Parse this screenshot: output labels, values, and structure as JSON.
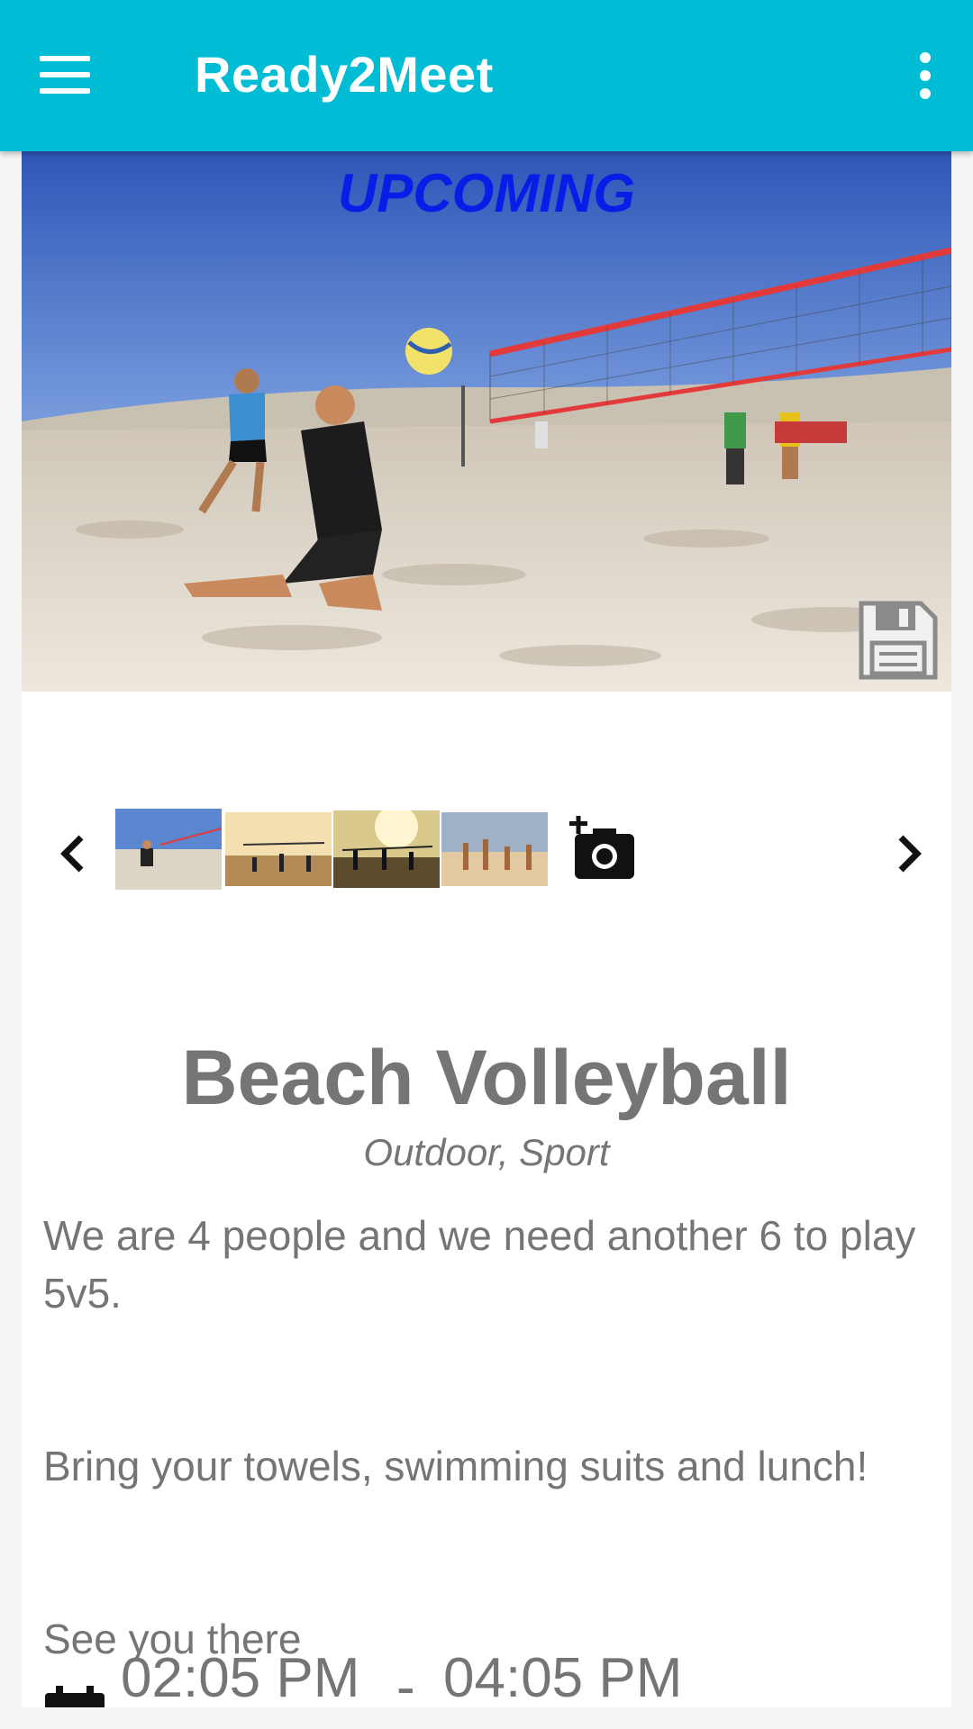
{
  "app": {
    "title": "Ready2Meet"
  },
  "icons": {
    "menu": "hamburger-menu-icon",
    "more": "more-vert-icon",
    "save": "floppy-save-icon",
    "prev": "chevron-left-icon",
    "next": "chevron-right-icon",
    "add_photo": "add-a-photo-icon",
    "calendar": "calendar-icon"
  },
  "colors": {
    "appbar": "#00bcd4",
    "status_label": "#0a1de6",
    "body_text": "#757575"
  },
  "event": {
    "status": "UPCOMING",
    "title": "Beach Volleyball",
    "categories": "Outdoor, Sport",
    "description": [
      "We are 4 people and we need another 6 to play 5v5.",
      "Bring your towels, swimming suits and lunch!",
      "See you there"
    ],
    "start_time": "02:05 PM",
    "time_separator": "-",
    "end_time": "04:05 PM"
  },
  "gallery": {
    "thumbnails": [
      "thumbnail-1",
      "thumbnail-2",
      "thumbnail-3",
      "thumbnail-4"
    ]
  }
}
